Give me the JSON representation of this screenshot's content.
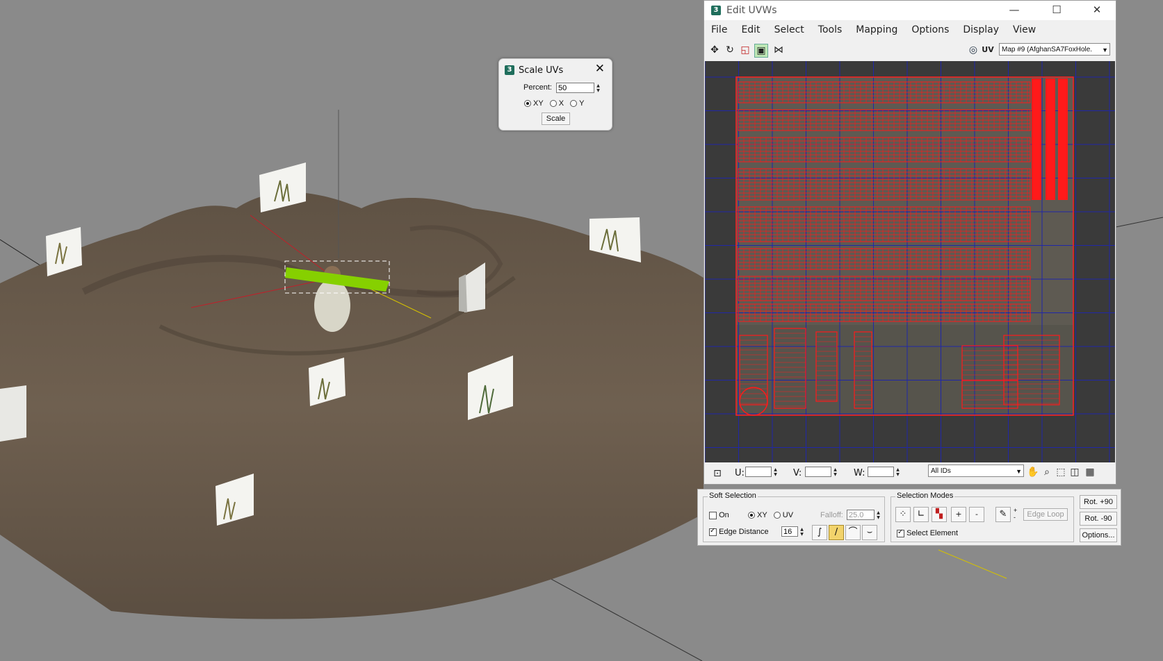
{
  "scale_dialog": {
    "title": "Scale UVs",
    "percent_label": "Percent:",
    "percent_value": "50",
    "axis_options": [
      "XY",
      "X",
      "Y"
    ],
    "axis_selected": "XY",
    "scale_button": "Scale"
  },
  "edit_uvws": {
    "title": "Edit UVWs",
    "menu": [
      "File",
      "Edit",
      "Select",
      "Tools",
      "Mapping",
      "Options",
      "Display",
      "View"
    ],
    "uv_label": "UV",
    "map_select": "Map #9 (AfghanSA7FoxHole.",
    "u_label": "U:",
    "v_label": "V:",
    "w_label": "W:",
    "ids_select": "All IDs"
  },
  "soft_selection": {
    "title": "Soft Selection",
    "on_label": "On",
    "on_checked": false,
    "modes": [
      "XY",
      "UV"
    ],
    "mode_selected": "XY",
    "falloff_label": "Falloff:",
    "falloff_value": "25.0",
    "edge_distance_label": "Edge Distance",
    "edge_distance_checked": true,
    "edge_distance_value": "16"
  },
  "selection_modes": {
    "title": "Selection Modes",
    "edge_loop": "Edge Loop",
    "select_element_label": "Select Element",
    "select_element_checked": true,
    "plus": "+",
    "minus": "-"
  },
  "rotate_buttons": {
    "rot_plus": "Rot. +90",
    "rot_minus": "Rot. -90",
    "options": "Options..."
  },
  "colors": {
    "viewport_bg": "#8a8a8a",
    "terrain": "#6d5e4d",
    "uv_wire": "#ff1a1a",
    "uv_grid": "#2027a8",
    "accent": "#1f6e5c"
  }
}
